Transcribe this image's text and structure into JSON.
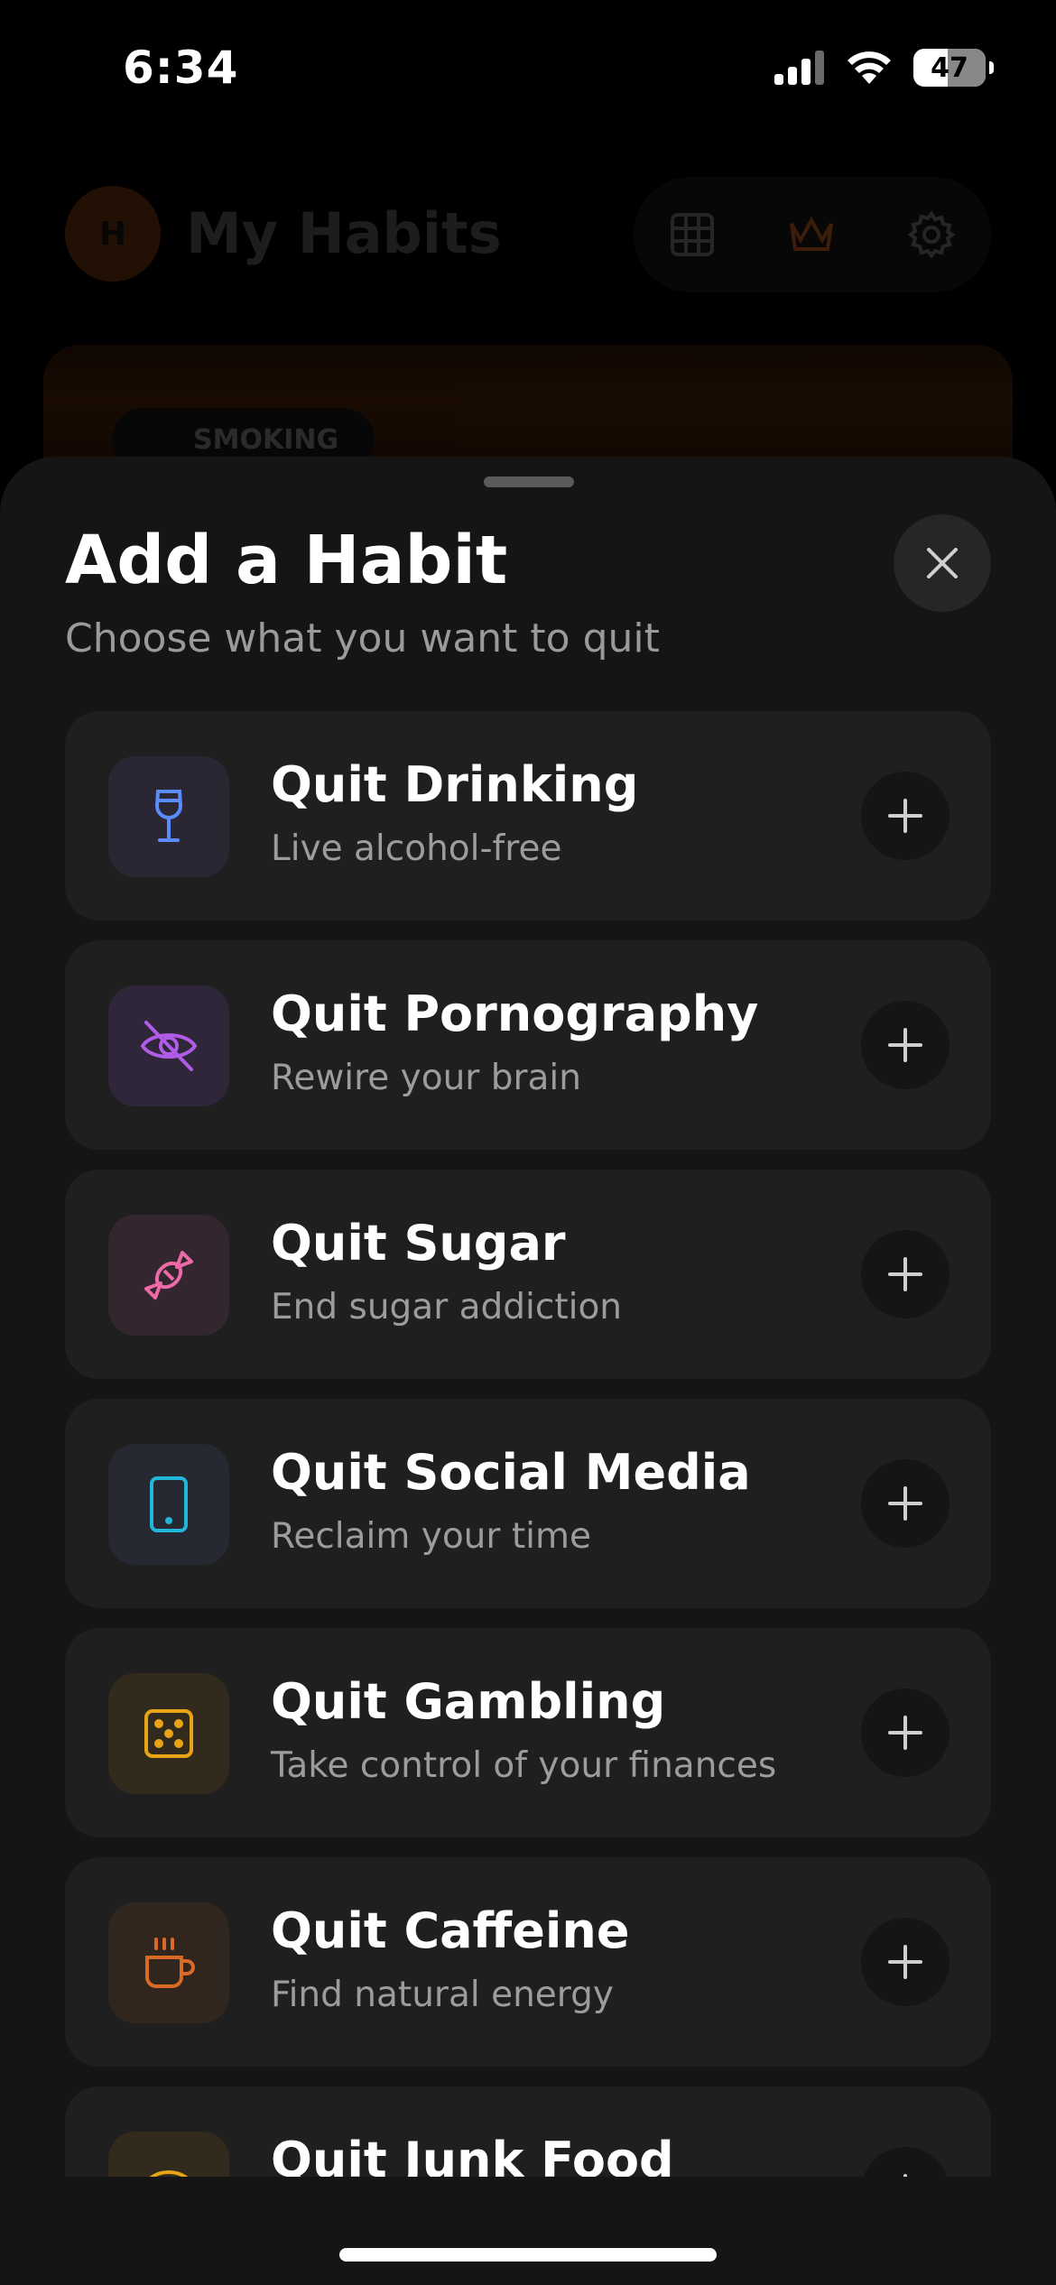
{
  "status_bar": {
    "time": "6:34",
    "battery": "47"
  },
  "background_app": {
    "avatar_initial": "H",
    "title": "My Habits",
    "chip_label": "SMOKING"
  },
  "sheet": {
    "title": "Add a Habit",
    "subtitle": "Choose what you want to quit",
    "habits": [
      {
        "name": "Quit Drinking",
        "description": "Live alcohol-free",
        "icon": "wine-glass-icon",
        "color": "#5b8cff",
        "bg": "#2a2634"
      },
      {
        "name": "Quit Pornography",
        "description": "Rewire your brain",
        "icon": "eye-off-icon",
        "color": "#b05ce8",
        "bg": "#30263a"
      },
      {
        "name": "Quit Sugar",
        "description": "End sugar addiction",
        "icon": "candy-icon",
        "color": "#ec6aa8",
        "bg": "#33262f"
      },
      {
        "name": "Quit Social Media",
        "description": "Reclaim your time",
        "icon": "smartphone-icon",
        "color": "#22b6d8",
        "bg": "#262832"
      },
      {
        "name": "Quit Gambling",
        "description": "Take control of your finances",
        "icon": "dice-icon",
        "color": "#e8a317",
        "bg": "#322a1c"
      },
      {
        "name": "Quit Caffeine",
        "description": "Find natural energy",
        "icon": "coffee-icon",
        "color": "#d96a26",
        "bg": "#30261d"
      },
      {
        "name": "Quit Junk Food",
        "description": "",
        "icon": "burger-icon",
        "color": "#e8a317",
        "bg": "#322a1c"
      }
    ]
  }
}
